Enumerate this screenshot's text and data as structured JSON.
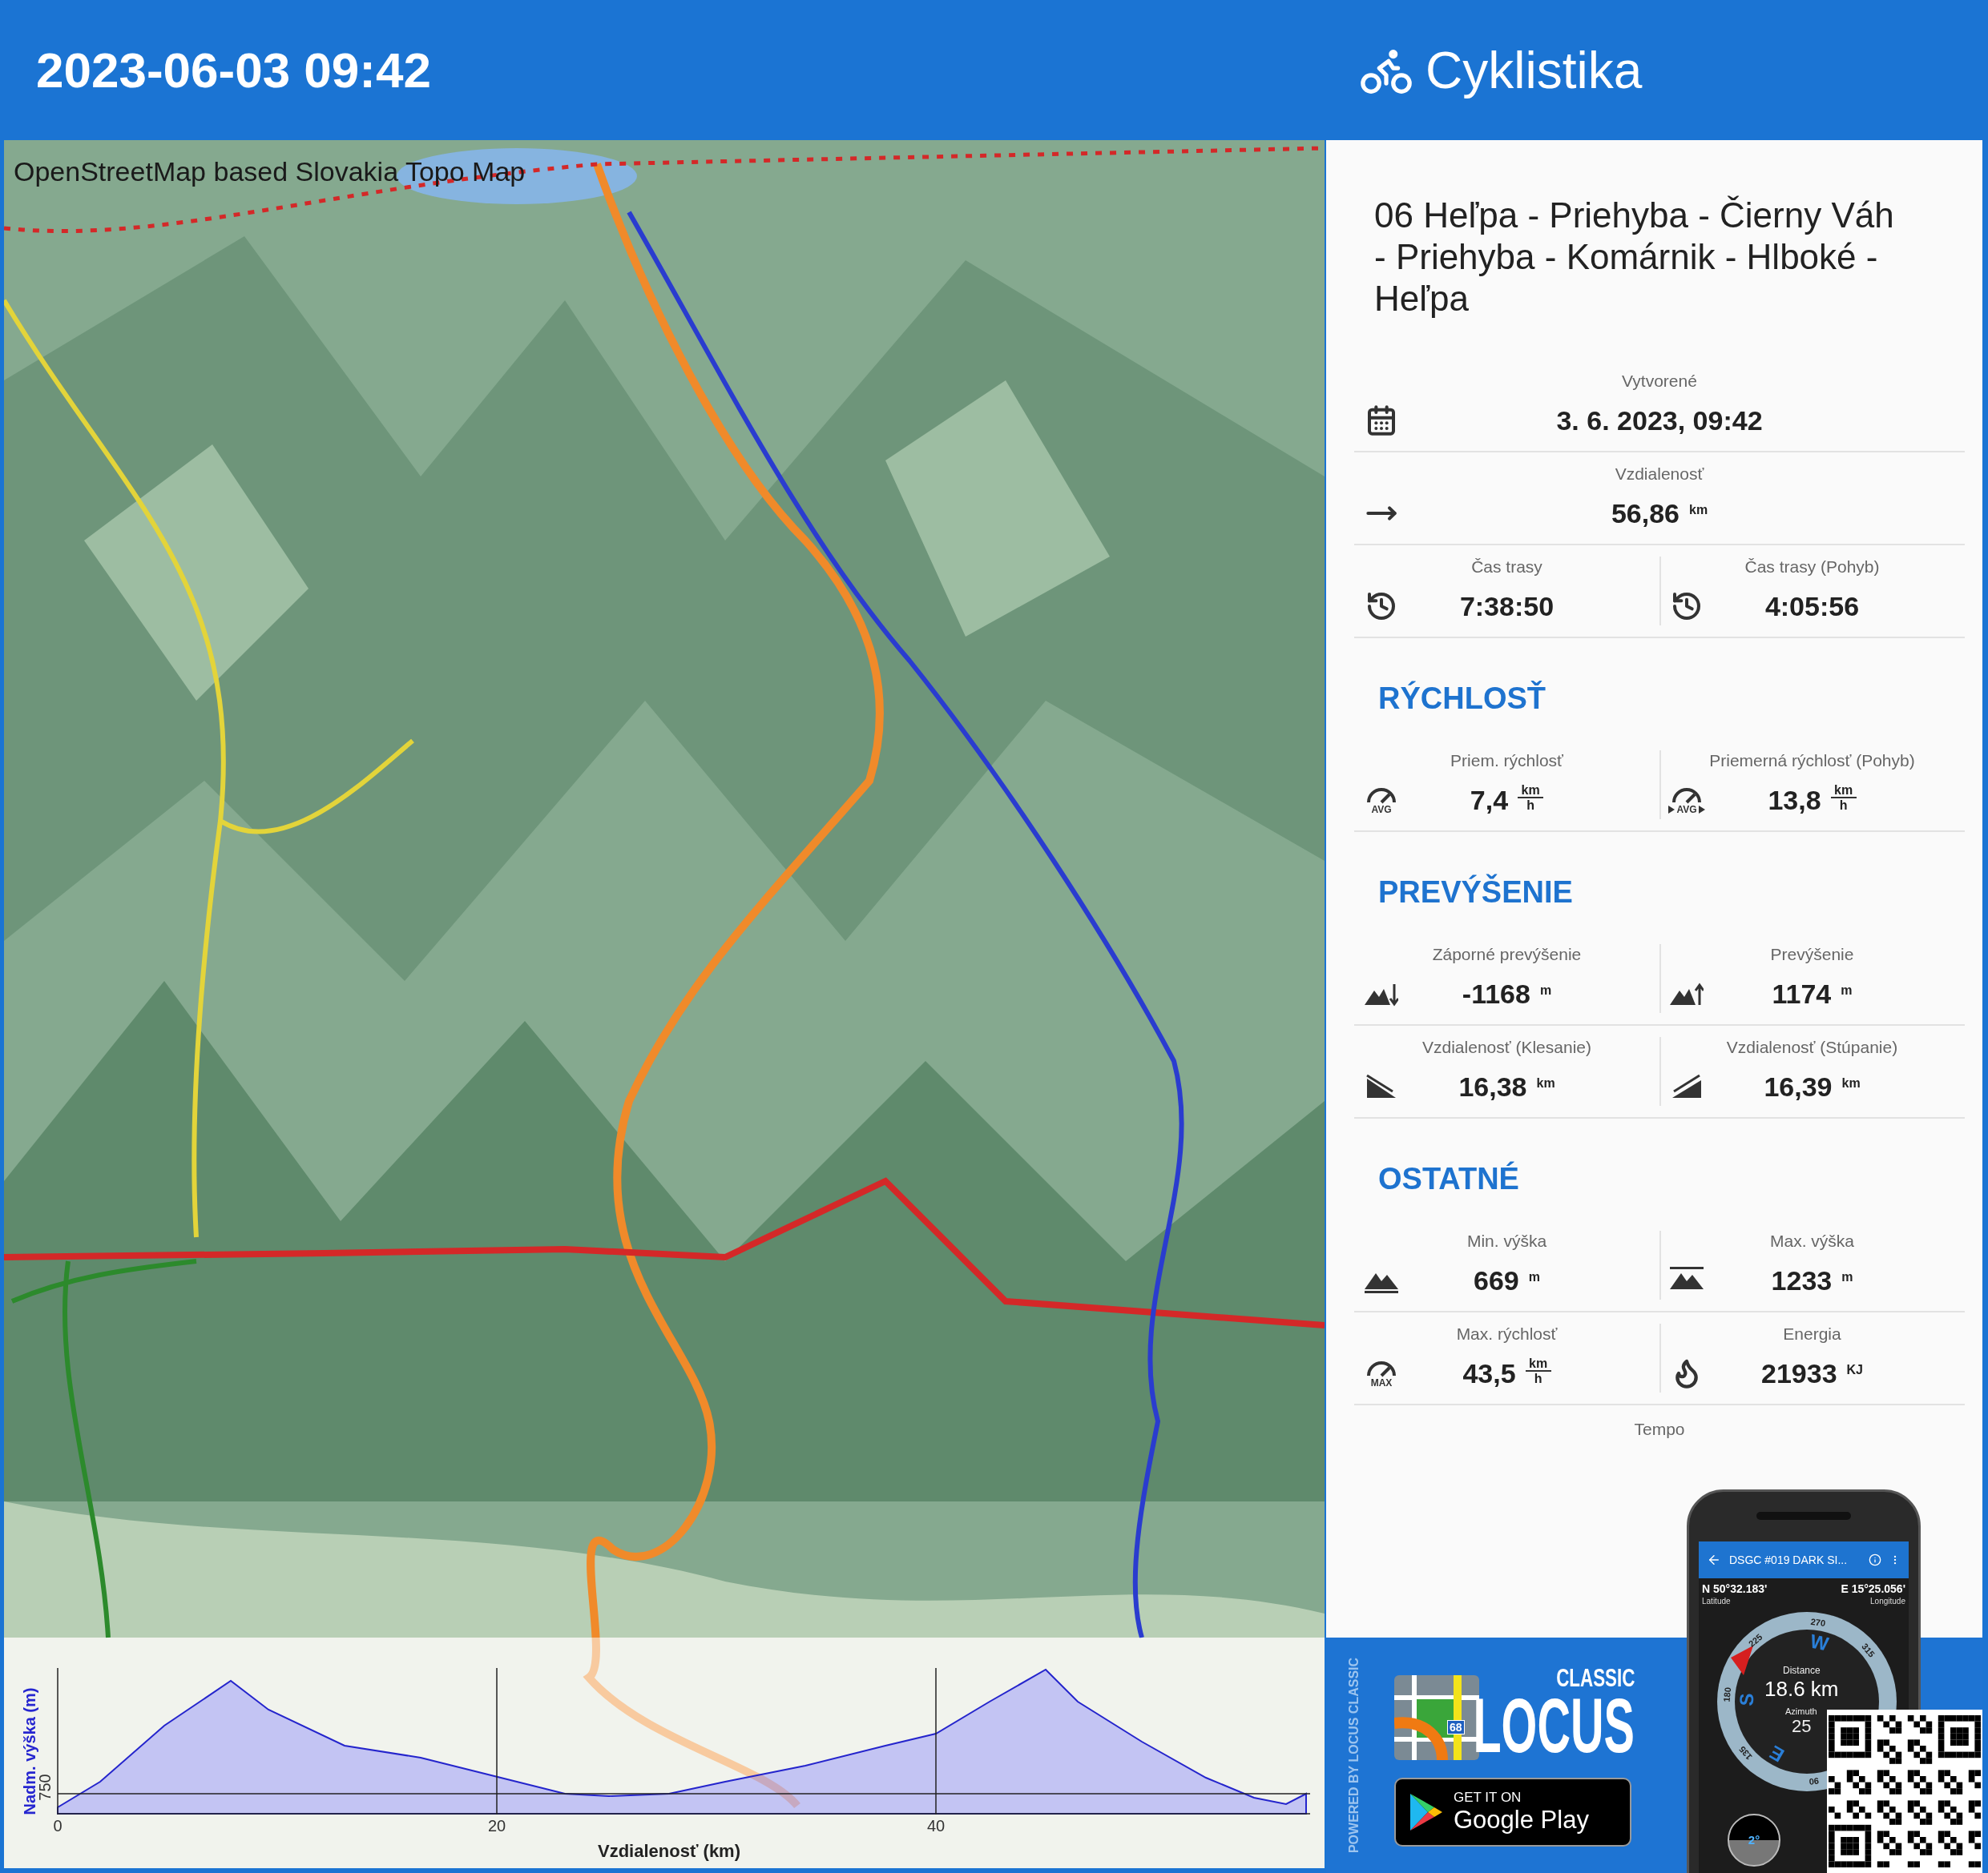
{
  "header": {
    "datetime": "2023-06-03 09:42",
    "activity": "Cyklistika"
  },
  "map": {
    "attribution": "OpenStreetMap based Slovakia Topo Map"
  },
  "elevation_profile": {
    "y_label": "Nadm. výška (m)",
    "y_tick": "750",
    "x_ticks": [
      "0",
      "20",
      "40"
    ],
    "x_label": "Vzdialenosť (km)"
  },
  "track": {
    "title": "06 Heľpa - Priehyba - Čierny Váh - Priehyba - Komárnik - Hlboké - Heľpa"
  },
  "sections": [
    {
      "rows": [
        [
          {
            "label": "Vytvorené",
            "value": "3. 6. 2023, 09:42",
            "kind": "calendar"
          }
        ],
        [
          {
            "label": "Vzdialenosť",
            "value": "56,86",
            "unit": "km",
            "kind": "arrow"
          }
        ],
        [
          {
            "label": "Čas trasy",
            "value": "7:38:50",
            "kind": "clock-path"
          },
          {
            "label": "Čas trasy (Pohyb)",
            "value": "4:05:56",
            "kind": "clock-moving"
          }
        ]
      ]
    },
    {
      "heading": "RÝCHLOSŤ",
      "rows": [
        [
          {
            "label": "Priem. rýchlosť",
            "value": "7,4",
            "unit": "km",
            "unit_per": "h",
            "kind": "gauge",
            "icon_text": "AVG"
          },
          {
            "label": "Priemerná rýchlosť (Pohyb)",
            "value": "13,8",
            "unit": "km",
            "unit_per": "h",
            "kind": "gauge-moving",
            "icon_text": "AVG"
          }
        ]
      ]
    },
    {
      "heading": "PREVÝŠENIE",
      "rows": [
        [
          {
            "label": "Záporné prevýšenie",
            "value": "-1168",
            "unit": "m",
            "kind": "mountain-down"
          },
          {
            "label": "Prevýšenie",
            "value": "1174",
            "unit": "m",
            "kind": "mountain-up"
          }
        ],
        [
          {
            "label": "Vzdialenosť (Klesanie)",
            "value": "16,38",
            "unit": "km",
            "kind": "slope-down"
          },
          {
            "label": "Vzdialenosť (Stúpanie)",
            "value": "16,39",
            "unit": "km",
            "kind": "slope-up"
          }
        ]
      ]
    },
    {
      "heading": "OSTATNÉ",
      "rows": [
        [
          {
            "label": "Min. výška",
            "value": "669",
            "unit": "m",
            "kind": "mountain"
          },
          {
            "label": "Max. výška",
            "value": "1233",
            "unit": "m",
            "kind": "mountain-top"
          }
        ],
        [
          {
            "label": "Max. rýchlosť",
            "value": "43,5",
            "unit": "km",
            "unit_per": "h",
            "kind": "gauge",
            "icon_text": "MAX"
          },
          {
            "label": "Energia",
            "value": "21933",
            "unit": "KJ",
            "kind": "flame"
          }
        ]
      ]
    }
  ],
  "footer_label": "Tempo",
  "promo": {
    "powered_by": "POWERED BY LOCUS CLASSIC",
    "logo_badge": "68",
    "logo_edition": "CLASSIC",
    "logo_name": "LOCUS",
    "store_line1": "GET IT ON",
    "store_line2": "Google Play",
    "phone": {
      "title": "DSGC #019 DARK SI...",
      "latitude": "N 50°32.183'",
      "latitude_label": "Latitude",
      "longitude": "E 15°25.056'",
      "longitude_label": "Longitude",
      "compass_marks": [
        "270",
        "225",
        "315",
        "180",
        "135",
        "90"
      ],
      "compass_letters": [
        "W",
        "S",
        "E"
      ],
      "distance_label": "Distance",
      "distance": "18.6 km",
      "azimuth_label": "Azimuth",
      "azimuth": "25",
      "tilt": "2°"
    }
  }
}
